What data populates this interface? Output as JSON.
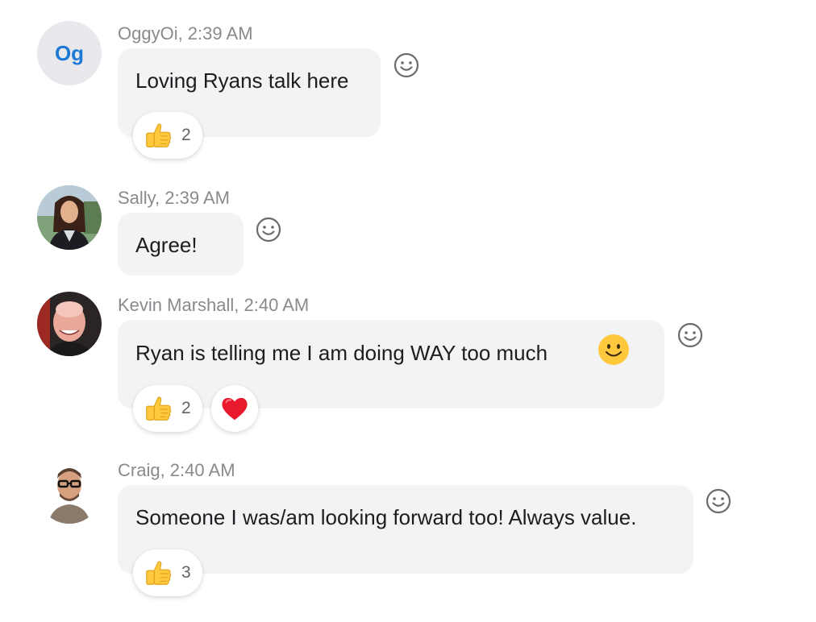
{
  "messages": [
    {
      "author": "OggyOi",
      "time": "2:39 AM",
      "meta": "OggyOi, 2:39 AM",
      "avatar_initials": "Og",
      "text": "Loving Ryans talk here",
      "reactions": [
        {
          "icon": "thumbs-up-icon",
          "count": "2"
        }
      ]
    },
    {
      "author": "Sally",
      "time": "2:39 AM",
      "meta": "Sally, 2:39 AM",
      "text": "Agree!",
      "reactions": []
    },
    {
      "author": "Kevin Marshall",
      "time": "2:40 AM",
      "meta": "Kevin Marshall, 2:40 AM",
      "text": "Ryan is telling me I am doing WAY too much",
      "inline_emoji": "smiley-icon",
      "reactions": [
        {
          "icon": "thumbs-up-icon",
          "count": "2"
        },
        {
          "icon": "heart-icon",
          "count": ""
        }
      ]
    },
    {
      "author": "Craig",
      "time": "2:40 AM",
      "meta": "Craig, 2:40 AM",
      "text": "Someone I was/am looking forward too! Always value.",
      "reactions": [
        {
          "icon": "thumbs-up-icon",
          "count": "3"
        }
      ]
    }
  ],
  "colors": {
    "bubble": "#f2f3f5",
    "meta_text": "#8a8a8e",
    "initials_text": "#1c7ad6",
    "heart": "#e8192c",
    "emoji_yellow": "#ffc83d"
  }
}
